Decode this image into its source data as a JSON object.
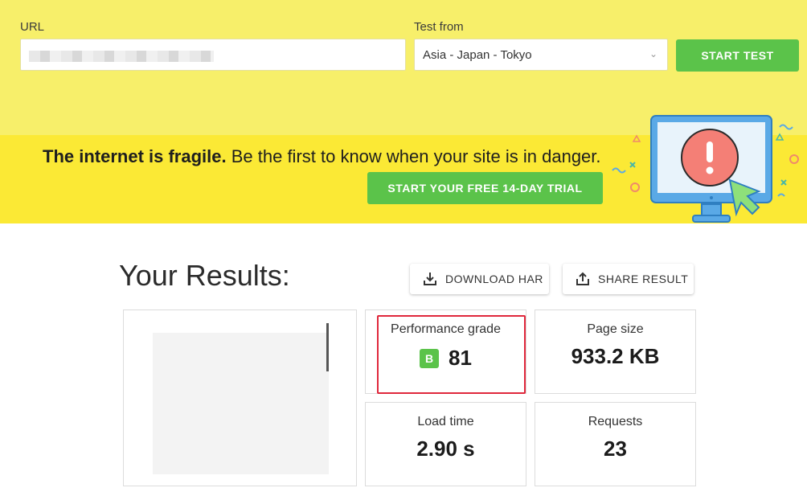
{
  "search": {
    "url_label": "URL",
    "url_value": "",
    "test_from_label": "Test from",
    "test_from_value": "Asia - Japan - Tokyo",
    "start_button": "START TEST"
  },
  "promo": {
    "headline_bold": "The internet is fragile.",
    "headline_rest": " Be the first to know when your site is in danger.",
    "trial_button": "START YOUR FREE 14-DAY TRIAL"
  },
  "results": {
    "title": "Your Results:",
    "download_button": "DOWNLOAD HAR",
    "share_button": "SHARE RESULT",
    "performance_label": "Performance grade",
    "performance_letter": "B",
    "performance_score": "81",
    "page_size_label": "Page size",
    "page_size_value": "933.2 KB",
    "load_time_label": "Load time",
    "load_time_value": "2.90 s",
    "requests_label": "Requests",
    "requests_value": "23"
  },
  "colors": {
    "search_band": "#f7ef6a",
    "promo_band": "#fbe935",
    "accent_green": "#5bc34a",
    "highlight_red": "#e0283c"
  },
  "icons": [
    "download-icon",
    "share-icon",
    "chevron-down-icon",
    "monitor-alert-illustration",
    "cursor-icon"
  ]
}
